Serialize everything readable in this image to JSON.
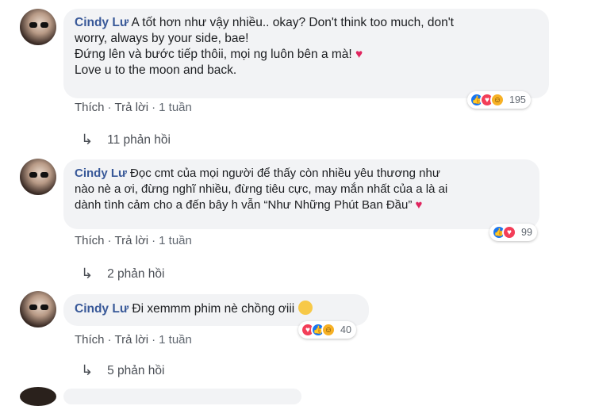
{
  "comments": [
    {
      "author": "Cindy Lư",
      "text_lines": [
        "A tốt hơn như vậy nhiều.. okay? Don't think too much, don't",
        "worry, always by your side, bae!",
        "Đứng lên và bước tiếp thôii, mọi ng luôn bên a mà!",
        "Love u to the moon and back."
      ],
      "like_label": "Thích",
      "reply_label": "Trả lời",
      "time": "1 tuần",
      "reaction_count": "195",
      "replies_label": "11 phản hồi"
    },
    {
      "author": "Cindy Lư",
      "text_lines": [
        "Đọc cmt của mọi người để thấy còn nhiều yêu thương như",
        "nào nè a ơi, đừng nghĩ nhiều, đừng tiêu cực, may mắn nhất của a là ai",
        "dành tình cảm cho a đến bây h vẫn “Như Những Phút Ban Đầu”"
      ],
      "like_label": "Thích",
      "reply_label": "Trả lời",
      "time": "1 tuần",
      "reaction_count": "99",
      "replies_label": "2 phản hồi"
    },
    {
      "author": "Cindy Lư",
      "text_lines": [
        "Đi xemmm phim nè chồng ơiii"
      ],
      "like_label": "Thích",
      "reply_label": "Trả lời",
      "time": "1 tuần",
      "reaction_count": "40",
      "replies_label": "5 phản hồi"
    }
  ],
  "separator": "·",
  "icons": {
    "heart": "♥",
    "reply_arrow": "↳",
    "like": "like-reaction",
    "love": "love-reaction",
    "haha": "haha-reaction"
  },
  "colors": {
    "name": "#385898",
    "bubble": "#f2f3f5",
    "heart": "#e0245e",
    "like": "#1877f2",
    "love": "#f33e58",
    "haha": "#f7b125"
  }
}
